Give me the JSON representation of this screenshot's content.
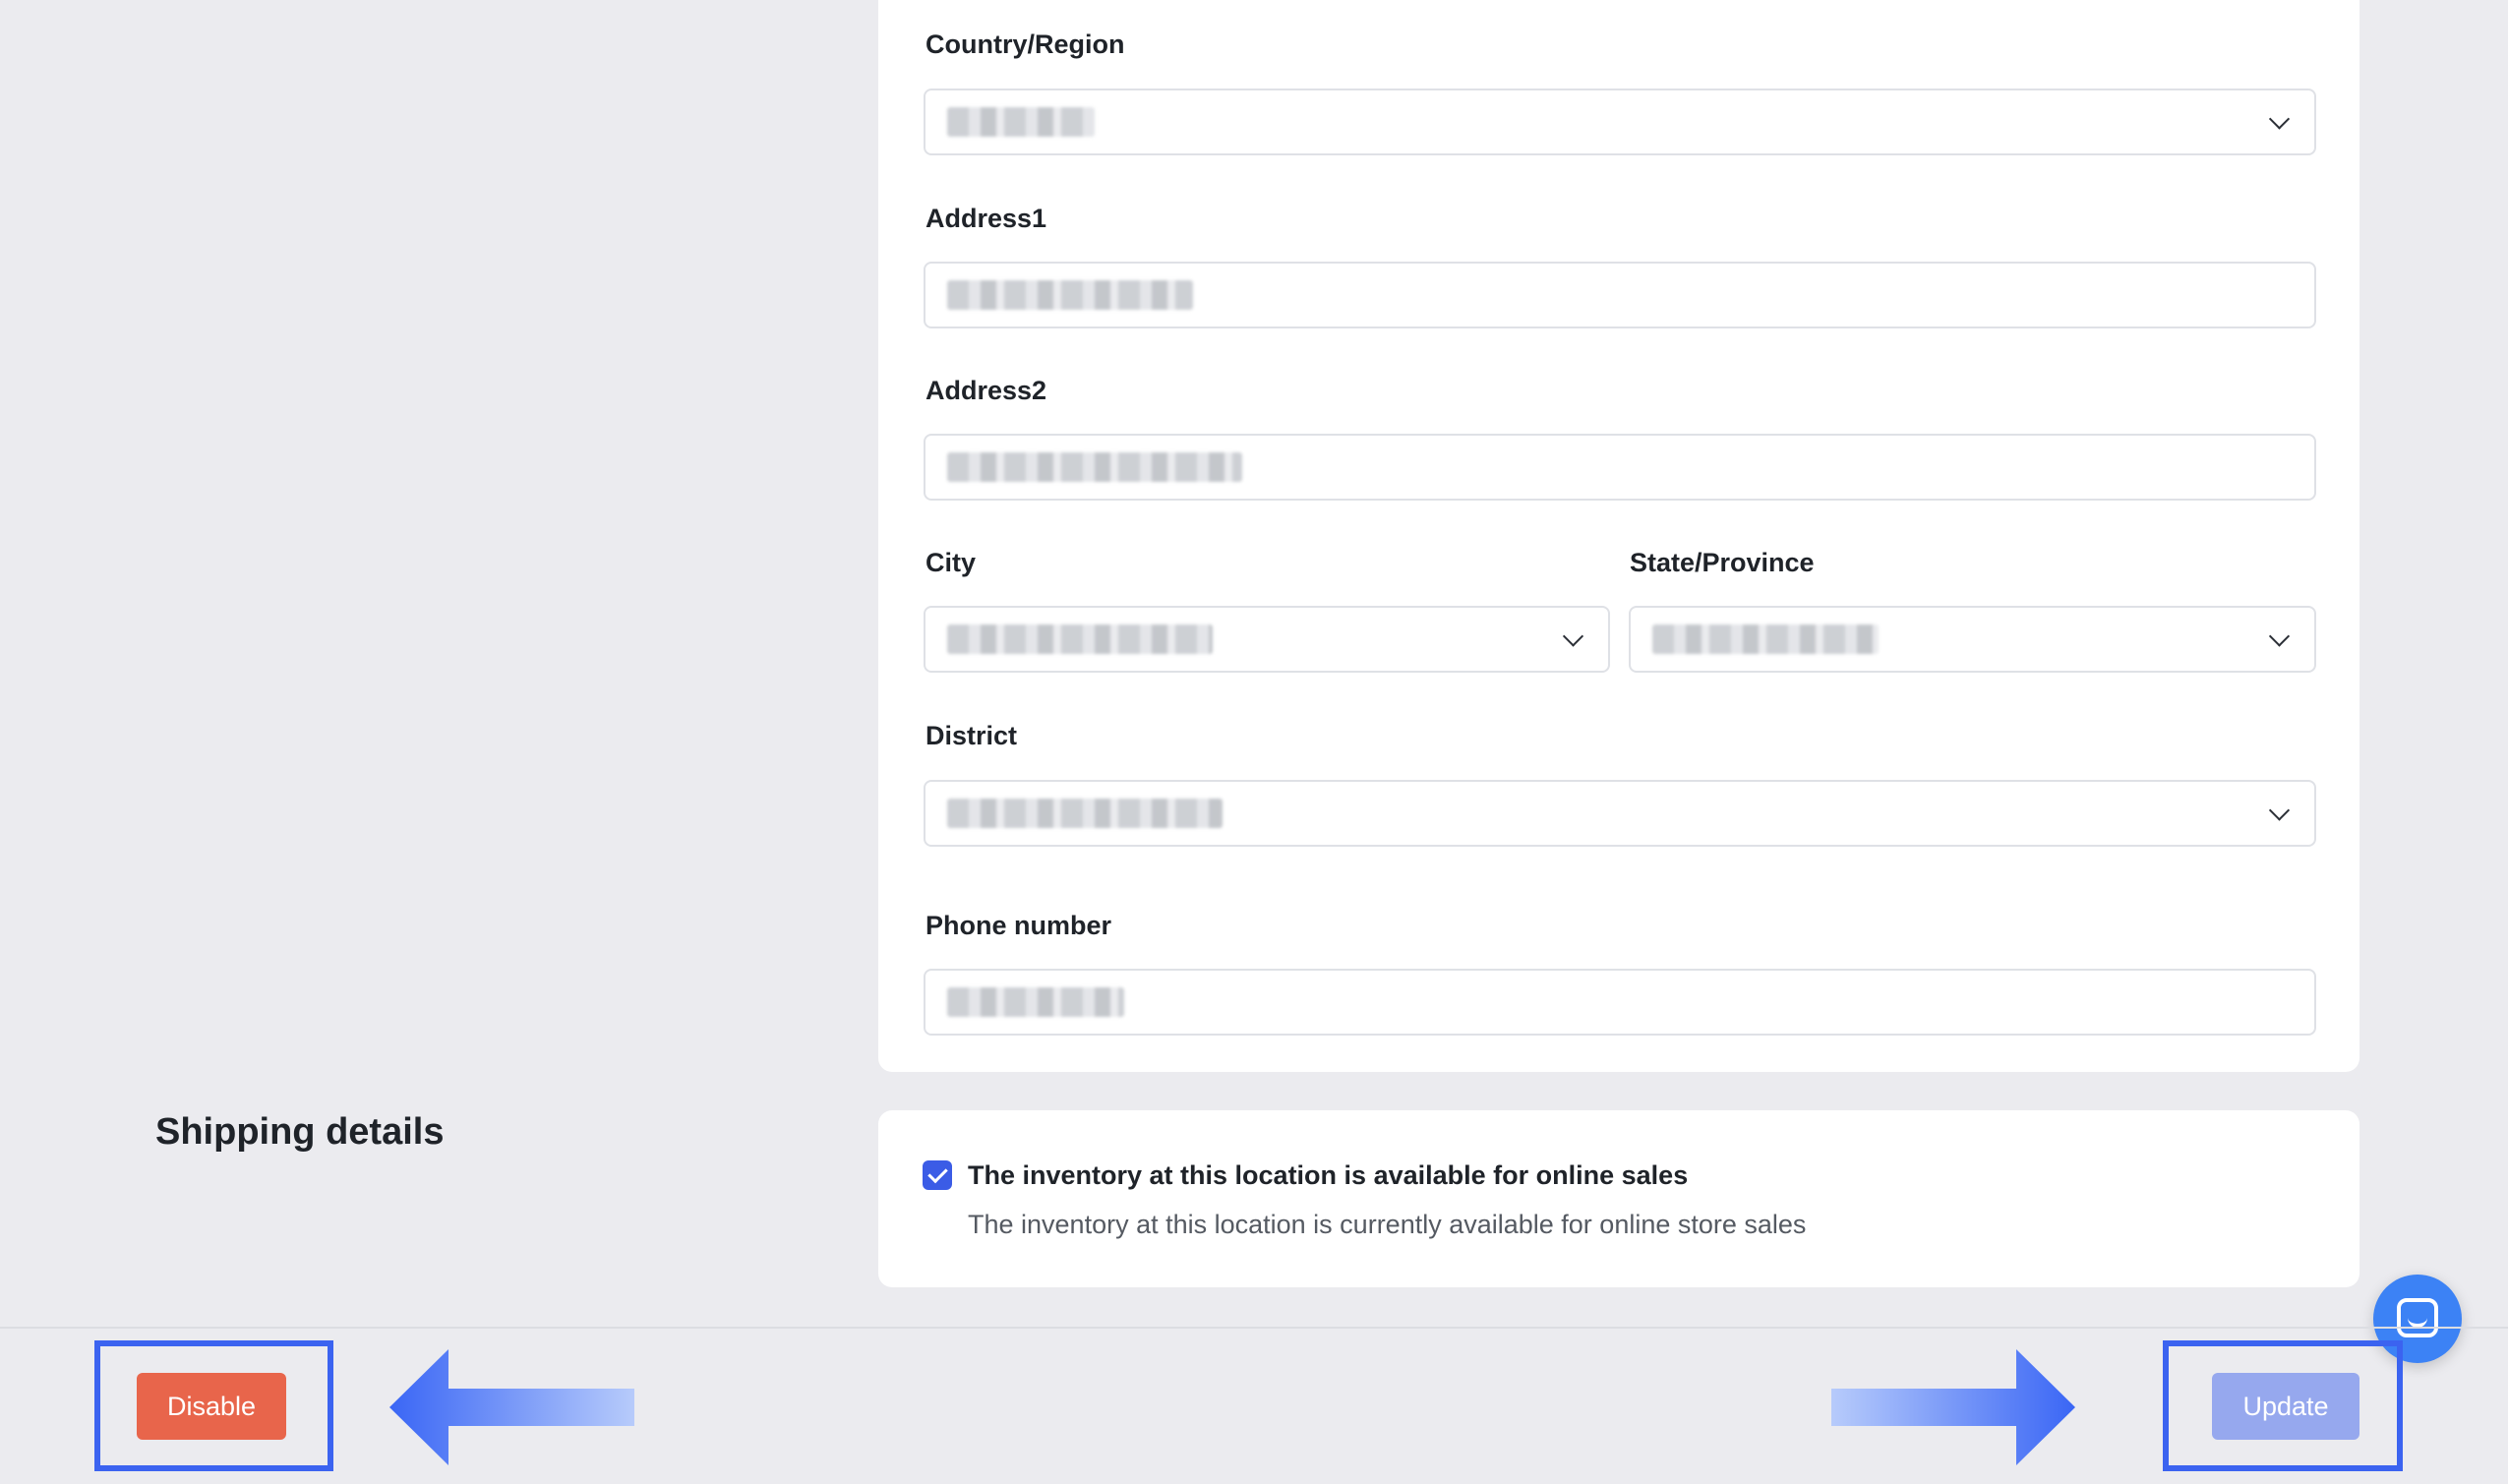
{
  "form": {
    "country_label": "Country/Region",
    "address1_label": "Address1",
    "address2_label": "Address2",
    "city_label": "City",
    "state_label": "State/Province",
    "district_label": "District",
    "phone_label": "Phone number"
  },
  "shipping": {
    "title": "Shipping details",
    "checkbox_checked": true,
    "checkbox_label": "The inventory at this location is available for online sales",
    "checkbox_description": "The inventory at this location is currently available for online store sales"
  },
  "footer": {
    "disable_label": "Disable",
    "update_label": "Update"
  },
  "colors": {
    "accent": "#3b5ce6",
    "disable_button": "#e8654b",
    "update_button": "#96a8ee",
    "highlight_border": "#3b63f0",
    "chat_bubble": "#3c82f5"
  },
  "icons": {
    "dropdown": "chevron-down-icon",
    "chat": "chat-icon",
    "annotation_arrows": [
      "arrow-left-icon",
      "arrow-right-icon"
    ]
  }
}
